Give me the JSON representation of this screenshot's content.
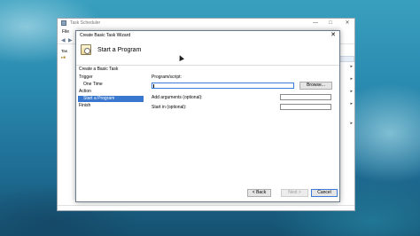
{
  "task_scheduler": {
    "title": "Task Scheduler",
    "controls": {
      "minimize": "—",
      "maximize": "□",
      "close": "✕"
    },
    "menu": {
      "file": "File"
    },
    "tree": {
      "item_label": "Tas"
    }
  },
  "wizard": {
    "title": "Create Basic Task Wizard",
    "close": "✕",
    "heading": "Start a Program",
    "steps": [
      {
        "label": "Create a Basic Task"
      },
      {
        "label": "Trigger"
      },
      {
        "label": "One Time"
      },
      {
        "label": "Action"
      },
      {
        "label": "Start a Program"
      },
      {
        "label": "Finish"
      }
    ],
    "program_label": "Program/script:",
    "program_value": "",
    "browse_label": "Browse...",
    "arguments_label": "Add arguments (optional):",
    "arguments_value": "",
    "startin_label": "Start in (optional):",
    "startin_value": "",
    "back_label": "< Back",
    "next_label": "Next >",
    "cancel_label": "Cancel"
  }
}
